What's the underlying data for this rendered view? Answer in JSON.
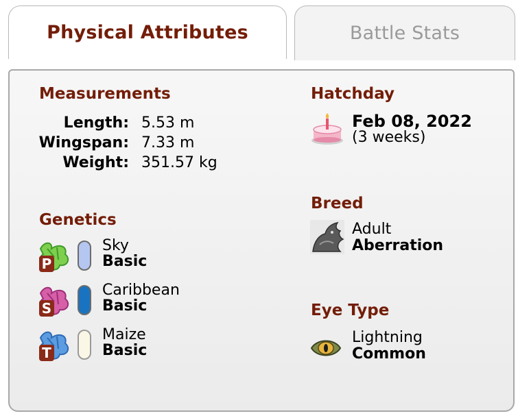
{
  "tabs": {
    "physical": "Physical Attributes",
    "battle": "Battle Stats"
  },
  "measurements": {
    "heading": "Measurements",
    "rows": [
      {
        "label": "Length:",
        "value": "5.53 m"
      },
      {
        "label": "Wingspan:",
        "value": "7.33 m"
      },
      {
        "label": "Weight:",
        "value": "351.57 kg"
      }
    ]
  },
  "genetics": {
    "heading": "Genetics",
    "genes": [
      {
        "slot_letter": "P",
        "color_name": "Sky",
        "gene": "Basic",
        "pill_color": "#b5c6f0",
        "icon_colors": [
          "#7fcf4e",
          "#3f9a2a"
        ]
      },
      {
        "slot_letter": "S",
        "color_name": "Caribbean",
        "gene": "Basic",
        "pill_color": "#1a73c0",
        "icon_colors": [
          "#d65fa8",
          "#9c2f78"
        ]
      },
      {
        "slot_letter": "T",
        "color_name": "Maize",
        "gene": "Basic",
        "pill_color": "#fbf7e6",
        "icon_colors": [
          "#5c9ce0",
          "#2f6ab5"
        ]
      }
    ]
  },
  "hatchday": {
    "heading": "Hatchday",
    "date": "Feb 08, 2022",
    "age": "(3 weeks)",
    "icon": "birthday-cake-icon"
  },
  "breed": {
    "heading": "Breed",
    "stage": "Adult",
    "name": "Aberration",
    "icon": "aberration-breed-icon"
  },
  "eye_type": {
    "heading": "Eye Type",
    "element": "Lightning",
    "rarity": "Common",
    "icon": "eye-icon"
  },
  "colors": {
    "accent": "#731d08",
    "inactive_tab_text": "#9a9a9a"
  }
}
